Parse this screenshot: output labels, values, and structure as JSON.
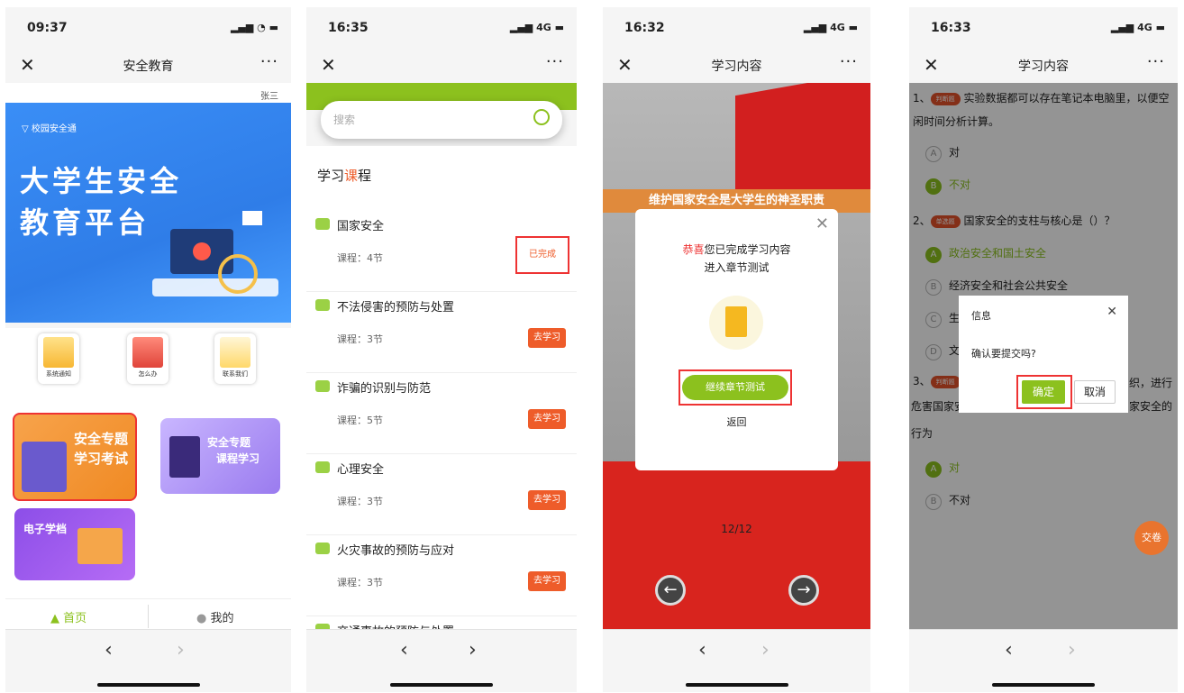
{
  "p1": {
    "time": "09:37",
    "title": "安全教育",
    "user": "张三",
    "brand": "校园安全通",
    "banner_line1": "大学生安全",
    "banner_line2": "教育平台",
    "icons": [
      "系统通知",
      "怎么办",
      "联系我们"
    ],
    "card1_line1": "安全专题",
    "card1_line2": "学习考试",
    "card2_line1": "安全专题",
    "card2_line2": "课程学习",
    "card3": "电子学档",
    "tab_home": "首页",
    "tab_me": "我的"
  },
  "p2": {
    "time": "16:35",
    "search_placeholder": "搜索",
    "section_a": "学习",
    "section_b": "课",
    "section_c": "程",
    "items": [
      {
        "name": "国家安全",
        "sub": "课程：4节",
        "action": "已完成"
      },
      {
        "name": "不法侵害的预防与处置",
        "sub": "课程：3节",
        "action": "去学习"
      },
      {
        "name": "诈骗的识别与防范",
        "sub": "课程：5节",
        "action": "去学习"
      },
      {
        "name": "心理安全",
        "sub": "课程：3节",
        "action": "去学习"
      },
      {
        "name": "火灾事故的预防与应对",
        "sub": "课程：3节",
        "action": "去学习"
      },
      {
        "name": "交通事故的预防与处置",
        "sub": "",
        "action": ""
      }
    ]
  },
  "p3": {
    "time": "16:32",
    "title": "学习内容",
    "ribbon": "维护国家安全是大学生的神圣职责",
    "msg_hl": "恭喜",
    "msg_1": "您已完成学习内容",
    "msg_2": "进入章节测试",
    "cta": "继续章节测试",
    "back": "返回",
    "page": "12/12"
  },
  "p4": {
    "time": "16:33",
    "title": "学习内容",
    "q1_num": "1、",
    "q1_tag": "判断题",
    "q1_text": "实验数据都可以存在笔记本电脑里，以便空闲时间分析计算。",
    "q1_opts": [
      {
        "k": "A",
        "t": "对"
      },
      {
        "k": "B",
        "t": "不对"
      }
    ],
    "q2_num": "2、",
    "q2_tag": "单选题",
    "q2_text": "国家安全的支柱与核心是（）？",
    "q2_opts": [
      {
        "k": "A",
        "t": "政治安全和国土安全"
      },
      {
        "k": "B",
        "t": "经济安全和社会公共安全"
      },
      {
        "k": "C",
        "t": "生"
      },
      {
        "k": "D",
        "t": "文"
      }
    ],
    "q3_num": "3、",
    "q3_tag": "判断题",
    "q3_frag1": "织，进行",
    "q3_frag2": "危害国家安",
    "q3_frag3": "家安全的",
    "q3_frag4": "行为",
    "q3_opts": [
      {
        "k": "A",
        "t": "对"
      },
      {
        "k": "B",
        "t": "不对"
      }
    ],
    "dlg_title": "信息",
    "dlg_msg": "确认要提交吗?",
    "ok": "确定",
    "cancel": "取消",
    "submit": "交卷"
  },
  "sig": "4G"
}
